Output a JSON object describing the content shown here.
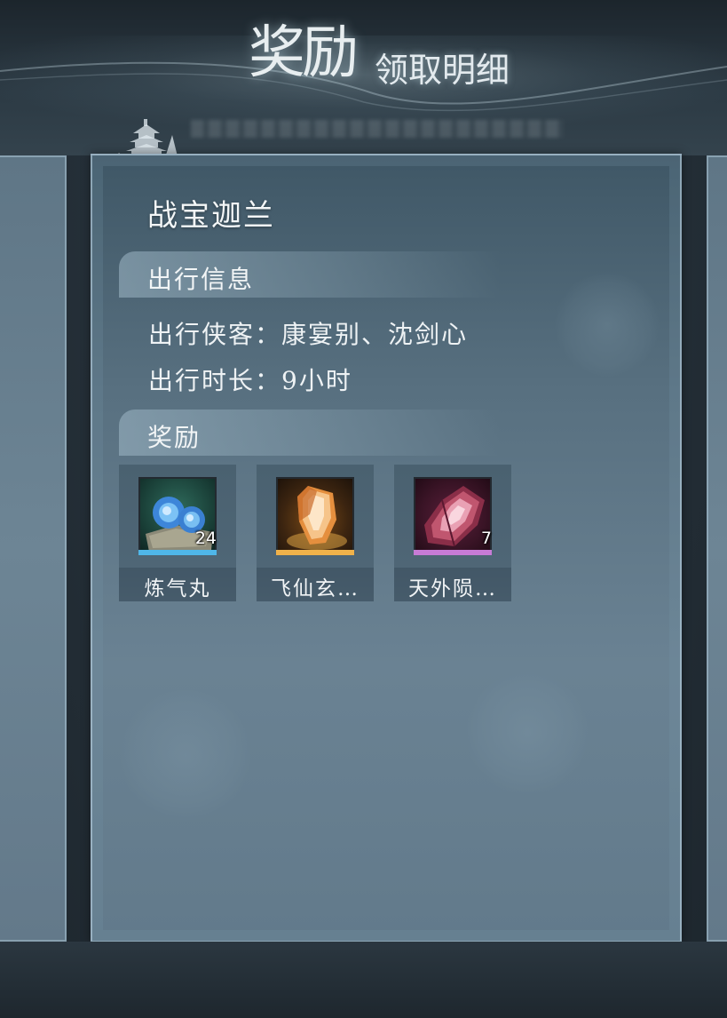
{
  "header": {
    "title_main": "奖励",
    "title_sub": "领取明细"
  },
  "panel": {
    "title": "战宝迦兰",
    "travel_section": {
      "label": "出行信息",
      "companions_label": "出行侠客：",
      "companions_value": "康宴别、沈剑心",
      "duration_label": "出行时长：",
      "duration_value": "9小时"
    },
    "reward_section": {
      "label": "奖励",
      "items": [
        {
          "name": "炼气丸",
          "quantity": "24",
          "icon": "blue-pills-icon",
          "rarity_color": "#4fb6e8"
        },
        {
          "name": "飞仙玄…",
          "quantity": "",
          "icon": "amber-crystal-icon",
          "rarity_color": "#f0b24a"
        },
        {
          "name": "天外陨…",
          "quantity": "7",
          "icon": "red-meteorite-icon",
          "rarity_color": "#c77bd6"
        }
      ]
    }
  }
}
